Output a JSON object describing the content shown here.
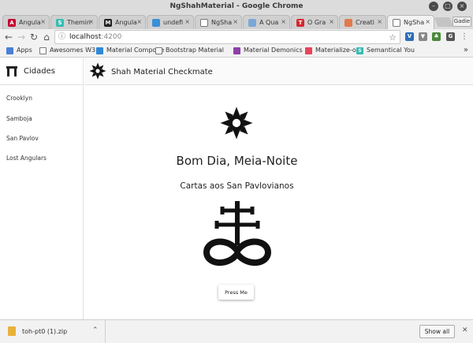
{
  "window": {
    "title": "NgShahMaterial - Google Chrome",
    "minimize_icon": "minimize-icon",
    "maximize_icon": "maximize-icon",
    "close_icon": "close-icon"
  },
  "tabs": [
    {
      "label": "Angula",
      "favicon": "A",
      "favicon_color": "#c3002f"
    },
    {
      "label": "Themin",
      "favicon": "S",
      "favicon_color": "#35bdb2"
    },
    {
      "label": "Angula",
      "favicon": "M",
      "favicon_color": "#222222"
    },
    {
      "label": "undefi",
      "favicon": "",
      "favicon_color": "#3b8fd9"
    },
    {
      "label": "NgSha",
      "favicon": "",
      "favicon_color": "#ffffff"
    },
    {
      "label": "A Qua",
      "favicon": "",
      "favicon_color": "#7aa7d6"
    },
    {
      "label": "O Gra",
      "favicon": "T",
      "favicon_color": "#d8262f"
    },
    {
      "label": "Creati",
      "favicon": "",
      "favicon_color": "#e2794a"
    },
    {
      "label": "NgSha",
      "favicon": "",
      "favicon_color": "#ffffff",
      "active": true
    }
  ],
  "profile_button": "Gadie",
  "address": {
    "host": "localhost",
    "port": ":4200"
  },
  "bookmarks": [
    {
      "label": "Apps",
      "icon_color": "#4a7fd6",
      "icon": ""
    },
    {
      "label": "Awesomes W3",
      "icon_color": "",
      "icon": "doc"
    },
    {
      "label": "Material Compone",
      "icon_color": "#2e88d8",
      "icon": ""
    },
    {
      "label": "Bootstrap Material",
      "icon_color": "",
      "icon": "doc"
    },
    {
      "label": "Material Demonics",
      "icon_color": "#8e3fa8",
      "icon": ""
    },
    {
      "label": "Materialize-o",
      "icon_color": "#e8445a",
      "icon": ""
    },
    {
      "label": "Semantical You",
      "icon_color": "#35bdb2",
      "icon": "S"
    }
  ],
  "sidenav": {
    "title": "Cidades",
    "items": [
      "Crooklyn",
      "Samboja",
      "San Pavlov",
      "Lost Angulars"
    ]
  },
  "app_toolbar": {
    "title": "Shah Material Checkmate"
  },
  "main": {
    "greeting": "Bom Dia, Meia-Noite",
    "subtitle": "Cartas aos San Pavlovianos",
    "button": "Press Me"
  },
  "downloads": {
    "filename": "toh-pt0 (1).zip",
    "show_all": "Show all"
  }
}
